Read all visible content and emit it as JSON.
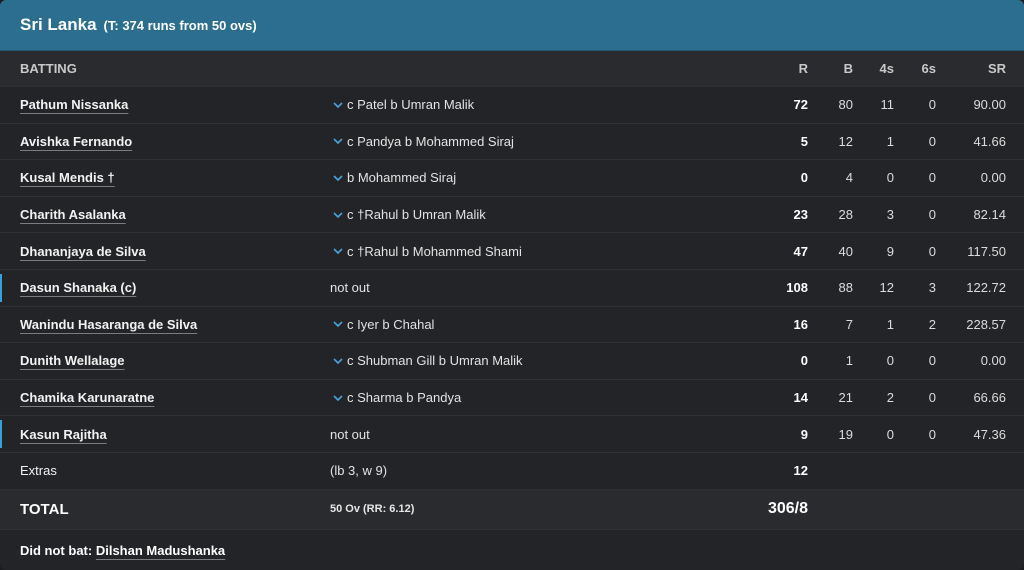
{
  "header": {
    "team": "Sri Lanka",
    "target": "(T: 374 runs from 50 ovs)"
  },
  "columns": {
    "batting": "BATTING",
    "r": "R",
    "b": "B",
    "fours": "4s",
    "sixes": "6s",
    "sr": "SR"
  },
  "batters": [
    {
      "name": "Pathum Nissanka",
      "dismissal": "c Patel b Umran Malik",
      "r": "72",
      "b": "80",
      "fours": "11",
      "sixes": "0",
      "sr": "90.00"
    },
    {
      "name": "Avishka Fernando",
      "dismissal": "c Pandya b Mohammed Siraj",
      "r": "5",
      "b": "12",
      "fours": "1",
      "sixes": "0",
      "sr": "41.66"
    },
    {
      "name": "Kusal Mendis †",
      "dismissal": "b Mohammed Siraj",
      "r": "0",
      "b": "4",
      "fours": "0",
      "sixes": "0",
      "sr": "0.00"
    },
    {
      "name": "Charith Asalanka",
      "dismissal": "c †Rahul b Umran Malik",
      "r": "23",
      "b": "28",
      "fours": "3",
      "sixes": "0",
      "sr": "82.14"
    },
    {
      "name": "Dhananjaya de Silva",
      "dismissal": "c †Rahul b Mohammed Shami",
      "r": "47",
      "b": "40",
      "fours": "9",
      "sixes": "0",
      "sr": "117.50"
    },
    {
      "name": "Dasun Shanaka (c)",
      "dismissal": "not out",
      "r": "108",
      "b": "88",
      "fours": "12",
      "sixes": "3",
      "sr": "122.72"
    },
    {
      "name": "Wanindu Hasaranga de Silva",
      "dismissal": "c Iyer b Chahal",
      "r": "16",
      "b": "7",
      "fours": "1",
      "sixes": "2",
      "sr": "228.57"
    },
    {
      "name": "Dunith Wellalage",
      "dismissal": "c Shubman Gill b Umran Malik",
      "r": "0",
      "b": "1",
      "fours": "0",
      "sixes": "0",
      "sr": "0.00"
    },
    {
      "name": "Chamika Karunaratne",
      "dismissal": "c Sharma b Pandya",
      "r": "14",
      "b": "21",
      "fours": "2",
      "sixes": "0",
      "sr": "66.66"
    },
    {
      "name": "Kasun Rajitha",
      "dismissal": "not out",
      "r": "9",
      "b": "19",
      "fours": "0",
      "sixes": "0",
      "sr": "47.36"
    }
  ],
  "extras": {
    "label": "Extras",
    "detail": "(lb 3, w 9)",
    "value": "12"
  },
  "total": {
    "label": "TOTAL",
    "overs": "50 Ov (RR: 6.12)",
    "score": "306/8"
  },
  "did_not_bat": {
    "label": "Did not bat:",
    "players": "Dilshan Madushanka"
  },
  "colors": {
    "header_bg": "#2b6e8f",
    "accent": "#3aa0d8",
    "panel": "#232427"
  }
}
